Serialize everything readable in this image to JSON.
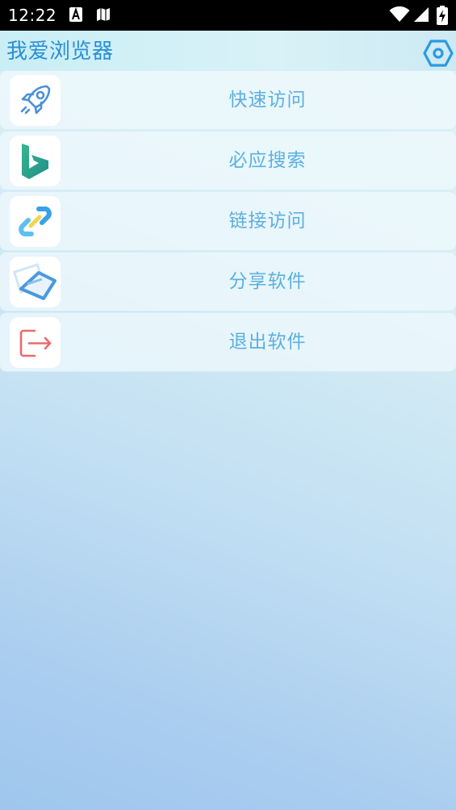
{
  "status_bar": {
    "time": "12:22",
    "icons": [
      "notification-a-icon",
      "map-icon",
      "wifi-icon",
      "signal-icon",
      "battery-charging-icon"
    ]
  },
  "app_bar": {
    "title": "我爱浏览器",
    "settings_icon": "hexagon-settings-icon"
  },
  "menu": {
    "items": [
      {
        "label": "快速访问",
        "icon": "rocket-icon",
        "icon_color": "#4a90d9"
      },
      {
        "label": "必应搜索",
        "icon": "bing-logo-icon",
        "icon_color": "#2bb08e"
      },
      {
        "label": "链接访问",
        "icon": "link-icon",
        "icon_color": "#3aa0e8"
      },
      {
        "label": "分享软件",
        "icon": "share-icon",
        "icon_color": "#4b98df"
      },
      {
        "label": "退出软件",
        "icon": "logout-icon",
        "icon_color": "#e86b6b"
      }
    ]
  },
  "colors": {
    "accent": "#2a8fd4",
    "label_text": "#5bb0e0",
    "status_bar_bg": "#000000"
  }
}
